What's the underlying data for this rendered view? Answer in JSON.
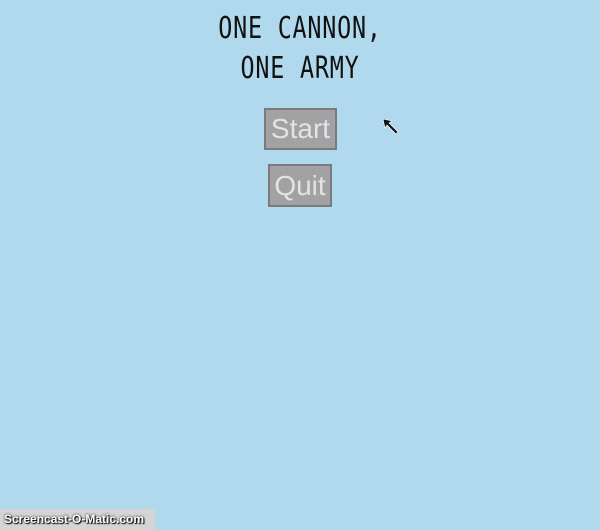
{
  "game": {
    "title_line_1": "ONE CANNON,",
    "title_line_2": "ONE ARMY"
  },
  "menu": {
    "start_label": "Start",
    "quit_label": "Quit"
  },
  "overlay": {
    "watermark": "Screencast-O-Matic.com",
    "cursor_icon": "arrow-cursor-icon"
  },
  "colors": {
    "background": "#b1d9ee",
    "button_fill": "#a2a2a4",
    "button_text": "#e3e3e3",
    "title_text": "#111111"
  }
}
